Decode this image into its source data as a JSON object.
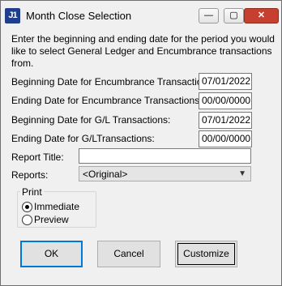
{
  "window": {
    "icon_text": "J1",
    "title": "Month Close Selection",
    "controls": {
      "minimize": "—",
      "maximize": "▢",
      "close": "✕"
    }
  },
  "intro": "Enter the beginning and ending date for the period you would like to select General Ledger and Encumbrance transactions from.",
  "fields": {
    "begin_encumbrance_label": "Beginning Date for Encumbrance Transactions:",
    "begin_encumbrance_value": "07/01/2022",
    "end_encumbrance_label": "Ending Date for Encumbrance Transactions:",
    "end_encumbrance_value": "00/00/0000",
    "begin_gl_label": "Beginning Date for G/L Transactions:",
    "begin_gl_value": "07/01/2022",
    "end_gl_label": "Ending Date for G/LTransactions:",
    "end_gl_value": "00/00/0000",
    "report_title_label": "Report Title:",
    "report_title_value": "",
    "reports_label": "Reports:",
    "reports_selected": "<Original>"
  },
  "print": {
    "group_label": "Print",
    "immediate_label": "Immediate",
    "preview_label": "Preview",
    "selected": "Immediate"
  },
  "buttons": {
    "ok": "OK",
    "cancel": "Cancel",
    "customize": "Customize"
  }
}
